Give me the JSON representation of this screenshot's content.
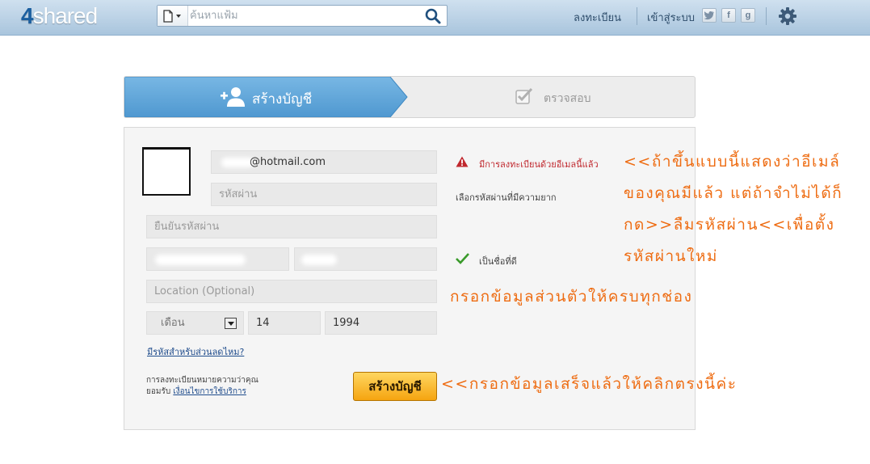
{
  "header": {
    "logo_num": "4",
    "logo_text": "shared",
    "search_placeholder": "ค้นหาแฟ้ม",
    "register_link": "ลงทะเบียน",
    "login_link": "เข้าสู่ระบบ",
    "social": [
      "twitter-icon",
      "facebook-icon",
      "google-icon"
    ],
    "social_glyphs": {
      "facebook": "f",
      "google": "g"
    }
  },
  "steps": {
    "step1_label": "สร้างบัญชี",
    "step2_label": "ตรวจสอบ"
  },
  "form": {
    "email_value": "@hotmail.com",
    "password_placeholder": "รหัสผ่าน",
    "confirm_password_placeholder": "ยืนยันรหัสผ่าน",
    "location_placeholder": "Location (Optional)",
    "month_value": "เดือน",
    "day_value": "14",
    "year_value": "1994",
    "promo_link": "มีรหัสสำหรับส่วนลดไหม?",
    "terms_text": "การลงทะเบียนหมายความว่าคุณยอมรับ",
    "terms_link": "เงื่อนไขการใช้บริการ",
    "submit_label": "สร้างบัญชี"
  },
  "messages": {
    "email_error": "มีการลงทะเบียนด้วยอีเมลนี้แล้ว",
    "password_hint": "เลือกรหัสผ่านที่มีความยาก",
    "name_ok": "เป็นชื่อที่ดี"
  },
  "annotations": {
    "note1": "<<ถ้าขึ้นแบบนี้แสดงว่าอีเมล์ของคุณมีแล้ว แต่ถ้าจำไม่ได้ก็กด>>ลืมรหัสผ่าน<<เพื่อตั้งรหัสผ่านใหม่",
    "note2": "กรอกข้อมูลส่วนตัวให้ครบทุกช่อง",
    "note3": "<<กรอกข้อมูลเสร็จแล้วให้คลิกตรงนี้ค่ะ"
  },
  "colors": {
    "accent_blue": "#5ea7dc",
    "annotation_orange": "#ee6c12",
    "button_orange": "#f5a410",
    "error_red": "#c0282e",
    "ok_green": "#3a9a2a"
  }
}
